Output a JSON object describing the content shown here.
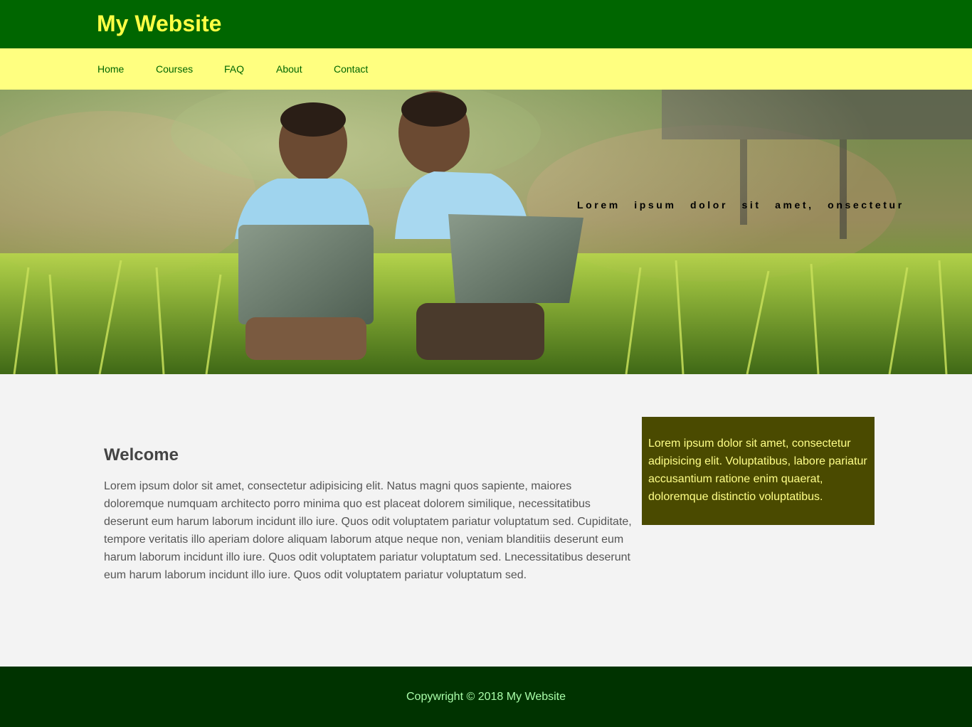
{
  "header": {
    "site_title": "My Website"
  },
  "nav": {
    "items": [
      {
        "label": "Home"
      },
      {
        "label": "Courses"
      },
      {
        "label": "FAQ"
      },
      {
        "label": "About"
      },
      {
        "label": "Contact"
      }
    ]
  },
  "hero": {
    "tagline": "Lorem ipsum dolor sit amet, onsectetur"
  },
  "main": {
    "welcome_title": "Welcome",
    "welcome_text": "Lorem ipsum dolor sit amet, consectetur adipisicing elit. Natus magni quos sapiente, maiores doloremque numquam architecto porro minima quo est placeat dolorem similique, necessitatibus deserunt eum harum laborum incidunt illo iure. Quos odit voluptatem pariatur voluptatum sed. Cupiditate, tempore veritatis illo aperiam dolore aliquam laborum atque neque non, veniam blanditiis deserunt eum harum laborum incidunt illo iure. Quos odit voluptatem pariatur voluptatum sed. Lnecessitatibus deserunt eum harum laborum incidunt illo iure. Quos odit voluptatem pariatur voluptatum sed."
  },
  "aside": {
    "text": "Lorem ipsum dolor sit amet, consectetur adipisicing elit. Voluptatibus, labore pariatur accusantium ratione enim quaerat, doloremque distinctio voluptatibus."
  },
  "footer": {
    "copyright": "Copywright © 2018 My Website"
  },
  "colors": {
    "header_bg": "#006600",
    "nav_bg": "#ffff80",
    "title_color": "#ffff44",
    "aside_bg": "#4a4a00",
    "footer_bg": "#003300"
  }
}
